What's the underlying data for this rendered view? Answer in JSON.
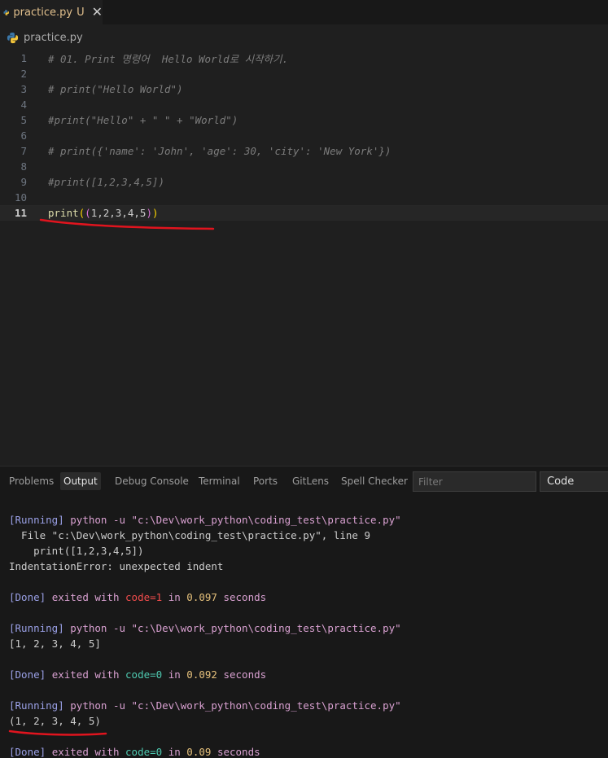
{
  "tab": {
    "label": "practice.py",
    "status": "U",
    "close": "✕"
  },
  "breadcrumb": {
    "label": "practice.py"
  },
  "editor": {
    "lines": [
      {
        "num": "1",
        "text": "# 01. Print 명령어  Hello World로 시작하기."
      },
      {
        "num": "2",
        "text": ""
      },
      {
        "num": "3",
        "text": "# print(\"Hello World\")"
      },
      {
        "num": "4",
        "text": ""
      },
      {
        "num": "5",
        "text": "#print(\"Hello\" + \" \" + \"World\")"
      },
      {
        "num": "6",
        "text": ""
      },
      {
        "num": "7",
        "text": "# print({'name': 'John', 'age': 30, 'city': 'New York'})"
      },
      {
        "num": "8",
        "text": ""
      },
      {
        "num": "9",
        "text": "#print([1,2,3,4,5])"
      },
      {
        "num": "10",
        "text": ""
      },
      {
        "num": "11",
        "text": ""
      }
    ],
    "current_line": {
      "fn": "print",
      "open1": "(",
      "open2": "(",
      "args": "1,2,3,4,5",
      "close2": ")",
      "close1": ")"
    }
  },
  "panel": {
    "tabs": [
      "Problems",
      "Output",
      "Debug Console",
      "Terminal",
      "Ports",
      "GitLens",
      "Spell Checker"
    ],
    "active_tab": "Output",
    "filter_placeholder": "Filter",
    "channel": "Code"
  },
  "output": {
    "running_tag": "[Running]",
    "command": "python -u \"c:\\Dev\\work_python\\coding_test\\practice.py\"",
    "traceback_file": "  File \"c:\\Dev\\work_python\\coding_test\\practice.py\", line 9",
    "traceback_code": "    print([1,2,3,4,5])",
    "error": "IndentationError: unexpected indent",
    "done_tag": "[Done]",
    "exited_with": "exited with",
    "code_err": "code=1",
    "code_ok": "code=0",
    "in": "in",
    "seconds": "seconds",
    "time1": "0.097",
    "result2": "[1, 2, 3, 4, 5]",
    "time2": "0.092",
    "result3": "(1, 2, 3, 4, 5)",
    "time3": "0.09"
  },
  "colors": {
    "annotation": "#e0141e",
    "modified": "#e2c08d"
  }
}
